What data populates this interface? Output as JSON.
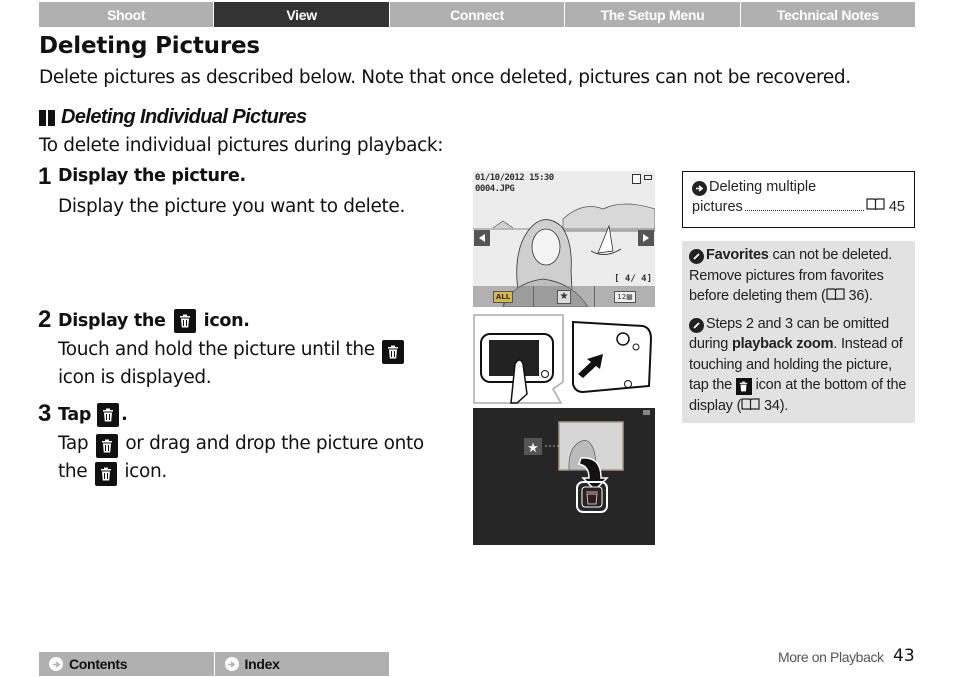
{
  "topnav": {
    "tabs": [
      {
        "label": "Shoot",
        "active": false
      },
      {
        "label": "View",
        "active": true
      },
      {
        "label": "Connect",
        "active": false
      },
      {
        "label": "The Setup Menu",
        "active": false
      },
      {
        "label": "Technical Notes",
        "active": false
      }
    ]
  },
  "page": {
    "title": "Deleting Pictures",
    "intro": "Delete pictures as described below. Note that once deleted, pictures can not be recovered.",
    "section_heading": "Deleting Individual Pictures",
    "lead": "To delete individual pictures during playback:"
  },
  "steps": [
    {
      "number": "1",
      "title": "Display the picture.",
      "desc": "Display the picture you want to delete."
    },
    {
      "number": "2",
      "title_before": "Display the",
      "title_after": "icon.",
      "desc_before": "Touch and hold the picture until the",
      "desc_after": "icon is displayed."
    },
    {
      "number": "3",
      "title_before": "Tap",
      "title_after": ".",
      "desc_a": "Tap",
      "desc_b": "or drag and drop the picture onto the",
      "desc_c": "icon."
    }
  ],
  "figure1": {
    "date": "01/10/2012 15:30",
    "filename": "0004.JPG",
    "counter": "[   4/   4]",
    "buttons": [
      "ALL",
      "favorite-star",
      "12-grid"
    ]
  },
  "xref": {
    "line1": "Deleting multiple",
    "line2": "pictures",
    "page": "45"
  },
  "notes": [
    {
      "bold": "Favorites",
      "text": " can not be deleted. Remove pictures from favorites before deleting them (",
      "page": "36",
      "end": ")."
    },
    {
      "text_a": "Steps 2 and 3 can be omitted during ",
      "bold": "playback zoom",
      "text_b": ". Instead of touching and holding the picture, tap the ",
      "text_c": " icon at the bottom of the display (",
      "page": "34",
      "end": ")."
    }
  ],
  "bottomnav": {
    "contents": "Contents",
    "index": "Index"
  },
  "footer": {
    "section": "More on Playback",
    "page_number": "43"
  },
  "colors": {
    "nav_bg": "#b0b0b0",
    "nav_active": "#333333",
    "note_bg": "#e2e2e2"
  }
}
